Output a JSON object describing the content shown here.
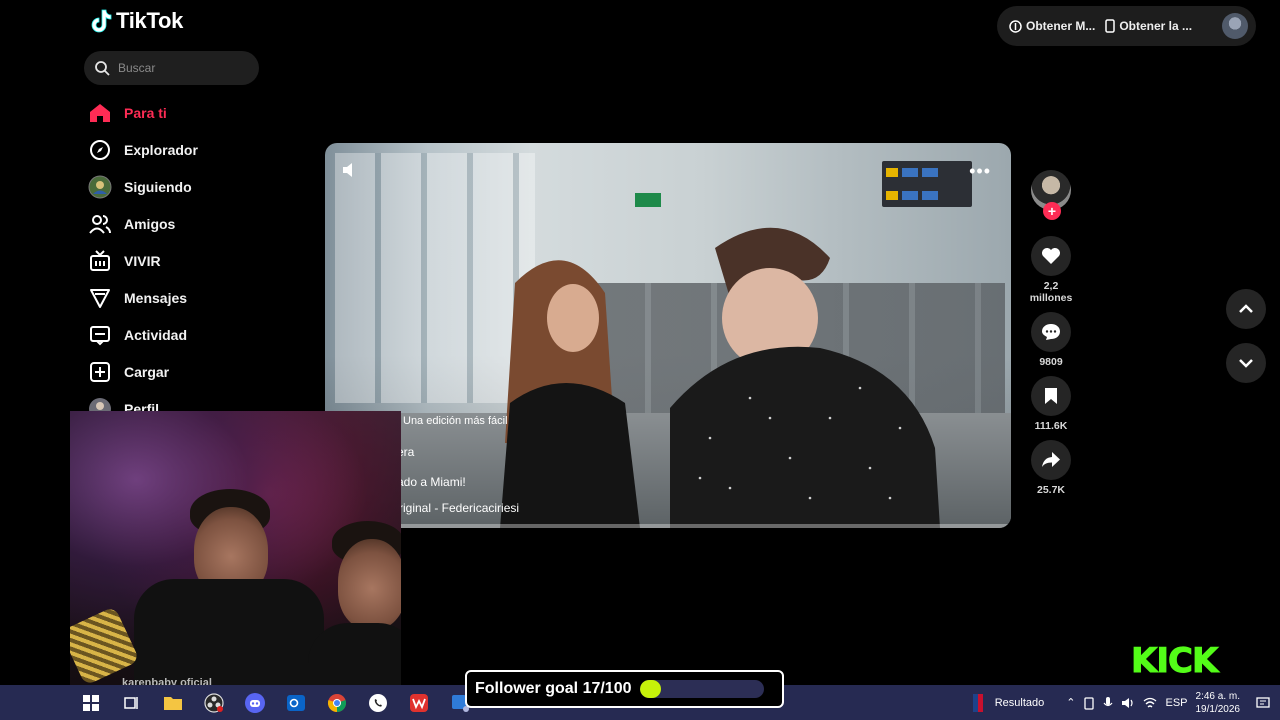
{
  "app": {
    "logo_text": "TikTok"
  },
  "search": {
    "placeholder": "Buscar"
  },
  "sidebar": {
    "items": [
      {
        "label": "Para ti",
        "icon": "home-icon",
        "active": true
      },
      {
        "label": "Explorador",
        "icon": "compass-icon"
      },
      {
        "label": "Siguiendo",
        "icon": "following-avatar-icon"
      },
      {
        "label": "Amigos",
        "icon": "friends-icon"
      },
      {
        "label": "VIVIR",
        "icon": "live-tv-icon"
      },
      {
        "label": "Mensajes",
        "icon": "send-icon"
      },
      {
        "label": "Actividad",
        "icon": "activity-icon"
      },
      {
        "label": "Cargar",
        "icon": "upload-plus-icon"
      },
      {
        "label": "Perfil",
        "icon": "profile-avatar-icon"
      }
    ]
  },
  "topbar": {
    "btn1": "Obtener M...",
    "btn2": "Obtener la ..."
  },
  "video": {
    "caption_lines": [
      "Una edición más fácil",
      "era",
      "ado a Miami!",
      "riginal - Federicaciriesi"
    ],
    "more": "•••"
  },
  "actions": {
    "follow_plus": "+",
    "likes": "2,2 millones",
    "comments": "9809",
    "saves": "111.6K",
    "shares": "25.7K"
  },
  "webcam": {
    "subtitle": "karenbaby oficial"
  },
  "kick": {
    "logo": "KICK",
    "color": "#53fc18"
  },
  "follower_goal": {
    "label": "Follower goal 17/100",
    "current": 17,
    "target": 100,
    "fill_fraction": 0.17,
    "fill_color": "#c6f20a"
  },
  "taskbar": {
    "search_label": "Resultado",
    "lang": "ESP",
    "time": "2:46 a. m.",
    "date": "19/1/2026"
  },
  "colors": {
    "accent": "#fe2c55",
    "background": "#000000",
    "taskbar": "#262a52"
  }
}
